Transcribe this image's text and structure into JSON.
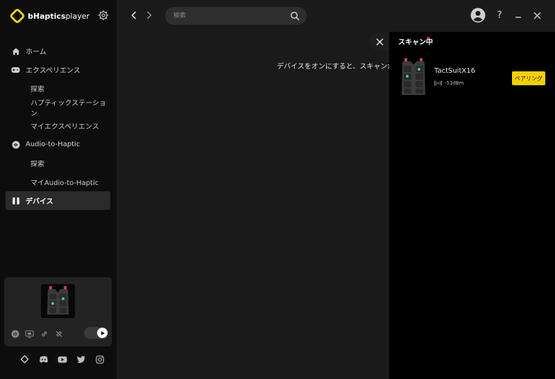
{
  "app": {
    "logo_brand": "bHaptics",
    "logo_product": "player"
  },
  "sidebar": {
    "items": [
      {
        "label": "ホーム",
        "icon": "home-icon"
      },
      {
        "label": "エクスペリエンス",
        "icon": "gamepad-icon"
      },
      {
        "label": "探索"
      },
      {
        "label": "ハプティックステーション"
      },
      {
        "label": "マイエクスペリエンス"
      },
      {
        "label": "Audio-to-Haptic",
        "icon": "audio-wave-icon"
      },
      {
        "label": "探索"
      },
      {
        "label": "マイAudio-to-Haptic"
      },
      {
        "label": "デバイス",
        "icon": "vest-icon",
        "active": true
      }
    ]
  },
  "search": {
    "placeholder": "検索"
  },
  "main": {
    "message": "デバイスをオンにすると、スキャンが始ま"
  },
  "scan_panel": {
    "title": "スキャン中",
    "device": {
      "name": "TactSuitX16",
      "signal": "-51dBm",
      "pair_label": "ペアリング"
    }
  },
  "colors": {
    "accent": "#f5d000",
    "scan_dot": "#e52b2b",
    "sidebar_bg": "#0d0d0d",
    "main_bg": "#1a1a1a",
    "panel_bg": "#000000"
  }
}
